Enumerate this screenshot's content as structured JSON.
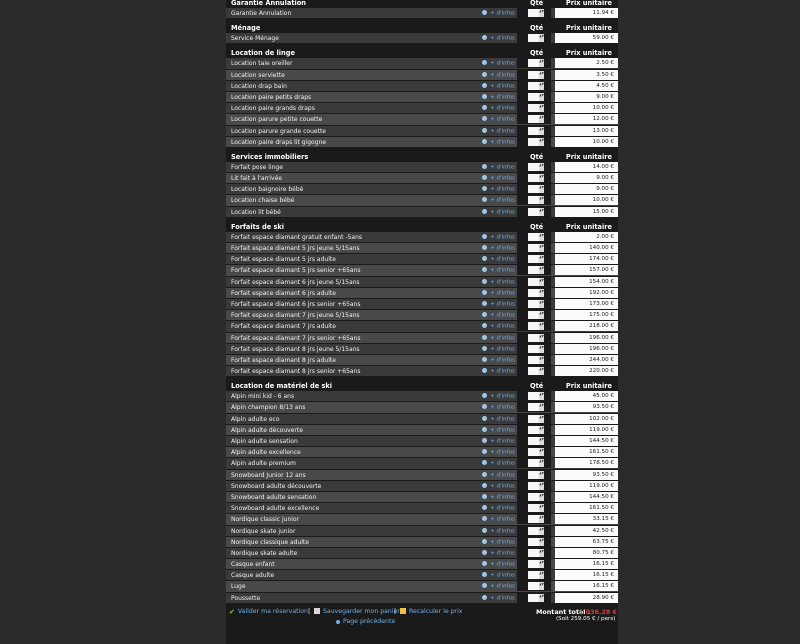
{
  "columns": {
    "qte": "Qté",
    "prix": "Prix unitaire"
  },
  "infos_label": "+ d'infos",
  "sections": [
    {
      "title": "Garantie Annulation",
      "items": [
        {
          "label": "Garantie Annulation",
          "price": "11.94 €"
        }
      ]
    },
    {
      "title": "Ménage",
      "items": [
        {
          "label": "Service Ménage",
          "price": "59.00 €"
        }
      ]
    },
    {
      "title": "Location de linge",
      "items": [
        {
          "label": "Location taie oreiller",
          "price": "2.50 €"
        },
        {
          "label": "Location serviette",
          "price": "3.50 €"
        },
        {
          "label": "Location drap bain",
          "price": "4.50 €"
        },
        {
          "label": "Location paire petits draps",
          "price": "9.00 €"
        },
        {
          "label": "Location paire grands draps",
          "price": "10.00 €"
        },
        {
          "label": "Location parure petite couette",
          "price": "12.00 €"
        },
        {
          "label": "Location parure grande couette",
          "price": "13.00 €"
        },
        {
          "label": "Location paire draps lit gigogne",
          "price": "10.00 €"
        }
      ]
    },
    {
      "title": "Services immobiliers",
      "items": [
        {
          "label": "Forfait pose linge",
          "price": "14.00 €"
        },
        {
          "label": "Lit fait à l'arrivée",
          "price": "9.00 €"
        },
        {
          "label": "Location baignoire bébé",
          "price": "9.00 €"
        },
        {
          "label": "Location chaise bébé",
          "price": "10.00 €"
        },
        {
          "label": "Location lit bébé",
          "price": "15.00 €"
        }
      ]
    },
    {
      "title": "Forfaits de ski",
      "items": [
        {
          "label": "Forfait espace diamant gratuit enfant -5ans",
          "price": "2.00 €"
        },
        {
          "label": "Forfait espace diamant 5 jrs jeune 5/15ans",
          "price": "140.00 €"
        },
        {
          "label": "Forfait espace diamant 5 jrs adulte",
          "price": "174.00 €"
        },
        {
          "label": "Forfait espace diamant 5 jrs senior +65ans",
          "price": "157.00 €"
        },
        {
          "label": "Forfait espace diamant 6 jrs jeune 5/15ans",
          "price": "154.00 €"
        },
        {
          "label": "Forfait espace diamant 6 jrs adulte",
          "price": "192.00 €"
        },
        {
          "label": "Forfait espace diamant 6 jrs senior +65ans",
          "price": "173.00 €"
        },
        {
          "label": "Forfait espace diamant 7 jrs jeune 5/15ans",
          "price": "175.00 €"
        },
        {
          "label": "Forfait espace diamant 7 jrs adulte",
          "price": "218.00 €"
        },
        {
          "label": "Forfait espace diamant 7 jrs senior +65ans",
          "price": "196.00 €"
        },
        {
          "label": "Forfait espace diamant 8 jrs jeune 5/15ans",
          "price": "196.00 €"
        },
        {
          "label": "Forfait espace diamant 8 jrs adulte",
          "price": "244.00 €"
        },
        {
          "label": "Forfait espace diamant 8 jrs senior +65ans",
          "price": "220.00 €"
        }
      ]
    },
    {
      "title": "Location de matériel de ski",
      "items": [
        {
          "label": "Alpin mini kid - 6 ans",
          "price": "45.00 €"
        },
        {
          "label": "Alpin champion 8/13 ans",
          "price": "93.50 €"
        },
        {
          "label": "Alpin adulte eco",
          "price": "102.00 €"
        },
        {
          "label": "Alpin adulte découverte",
          "price": "119.00 €"
        },
        {
          "label": "Alpin adulte sensation",
          "price": "144.50 €"
        },
        {
          "label": "Alpin adulte excellence",
          "price": "161.50 €"
        },
        {
          "label": "Alpin adulte premium",
          "price": "178.50 €"
        },
        {
          "label": "Snowboard Junior 12 ans",
          "price": "93.50 €"
        },
        {
          "label": "Snowboard adulte découverte",
          "price": "119.00 €"
        },
        {
          "label": "Snowboard adulte sensation",
          "price": "144.50 €"
        },
        {
          "label": "Snowboard adulte excellence",
          "price": "161.50 €"
        },
        {
          "label": "Nordique classic junior",
          "price": "33.15 €"
        },
        {
          "label": "Nordique skate junior",
          "price": "42.50 €"
        },
        {
          "label": "Nordique classique adulte",
          "price": "63.75 €"
        },
        {
          "label": "Nordique skate adulte",
          "price": "80.75 €"
        },
        {
          "label": "Casque enfant",
          "price": "16.15 €"
        },
        {
          "label": "Casque adulte",
          "price": "16.15 €"
        },
        {
          "label": "Luge",
          "price": "16.15 €"
        },
        {
          "label": "Poussette",
          "price": "28.90 €"
        }
      ]
    }
  ],
  "footer": {
    "valider": "Valider ma réservation",
    "sauvegarder": "Sauvegarder mon panier",
    "recalculer": "Recalculer le prix",
    "precedente": "Page précédente",
    "separator": "|",
    "total_label": "Montant total :",
    "total_value": "1 036.28 €",
    "soit": "(Soit 259.05 € / pers)",
    "colors": {
      "link": "#6fb1e8",
      "total": "#e53935",
      "check": "#8bc34a"
    }
  }
}
